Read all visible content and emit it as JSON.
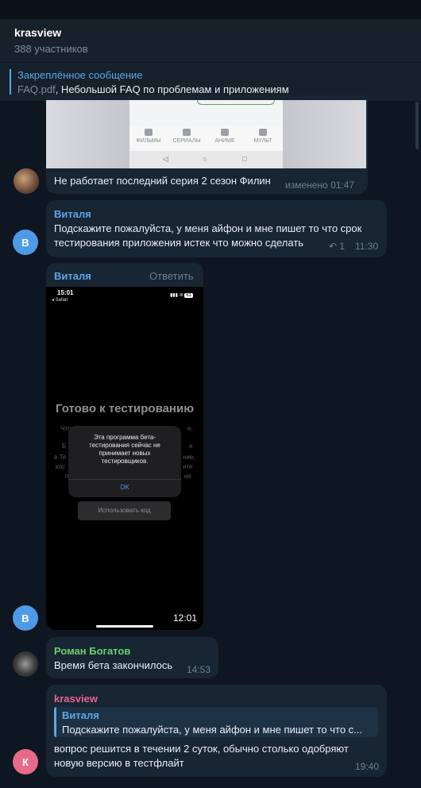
{
  "header": {
    "title": "krasview",
    "subtitle": "388 участников"
  },
  "pinned": {
    "label": "Закреплённое сообщение",
    "file": "FAQ.pdf",
    "text": ", Небольшой FAQ по проблемам и приложениям"
  },
  "messages": [
    {
      "image_tabs": [
        "ФИЛЬМЫ",
        "СЕРИАЛЫ",
        "АНИМЕ",
        "МУЛЬТ"
      ],
      "image_nav": [
        "◁",
        "○",
        "□"
      ],
      "text": "Не работает последний серия 2 сезон Филин",
      "time": "изменено 01:47"
    },
    {
      "sender": "Виталя",
      "avatar_letter": "В",
      "text": "Подскажите пожалуйста, у меня айфон и мне пишет то что срок тестирования приложения истек что можно сделать",
      "replies": "1",
      "time": "11:30"
    },
    {
      "sender": "Виталя",
      "reply_label": "Ответить",
      "avatar_letter": "В",
      "phone": {
        "clock": "15:01",
        "back": "◂ Safari",
        "battery": "61",
        "heading": "Готово к тестированию",
        "bg_lines": [
          "Что",
          "в Те",
          "кос",
          "п",
          "Б"
        ],
        "bg_right": [
          "е,",
          "ние,",
          "ите",
          "ня",
          "е"
        ],
        "dialog_text": "Эта программа бета-тестирования сейчас не принимает новых тестировщиков.",
        "dialog_ok": "OK",
        "use_code": "Использовать код"
      },
      "time": "12:01"
    },
    {
      "sender": "Роман Богатов",
      "text": "Время бета закончилось",
      "time": "14:53"
    },
    {
      "sender": "krasview",
      "avatar_letter": "К",
      "quote_name": "Виталя",
      "quote_text": "Подскажите пожалуйста, у меня айфон и мне пишет то что с...",
      "text": "вопрос решится в течении 2 суток, обычно столько одобряют новую версию в тестфлайт",
      "time": "19:40"
    }
  ],
  "colors": {
    "background": "#0e1621",
    "bubble": "#182533",
    "accent": "#5ea5e8",
    "sender_green": "#6fce6f",
    "sender_pink": "#e8638f"
  }
}
